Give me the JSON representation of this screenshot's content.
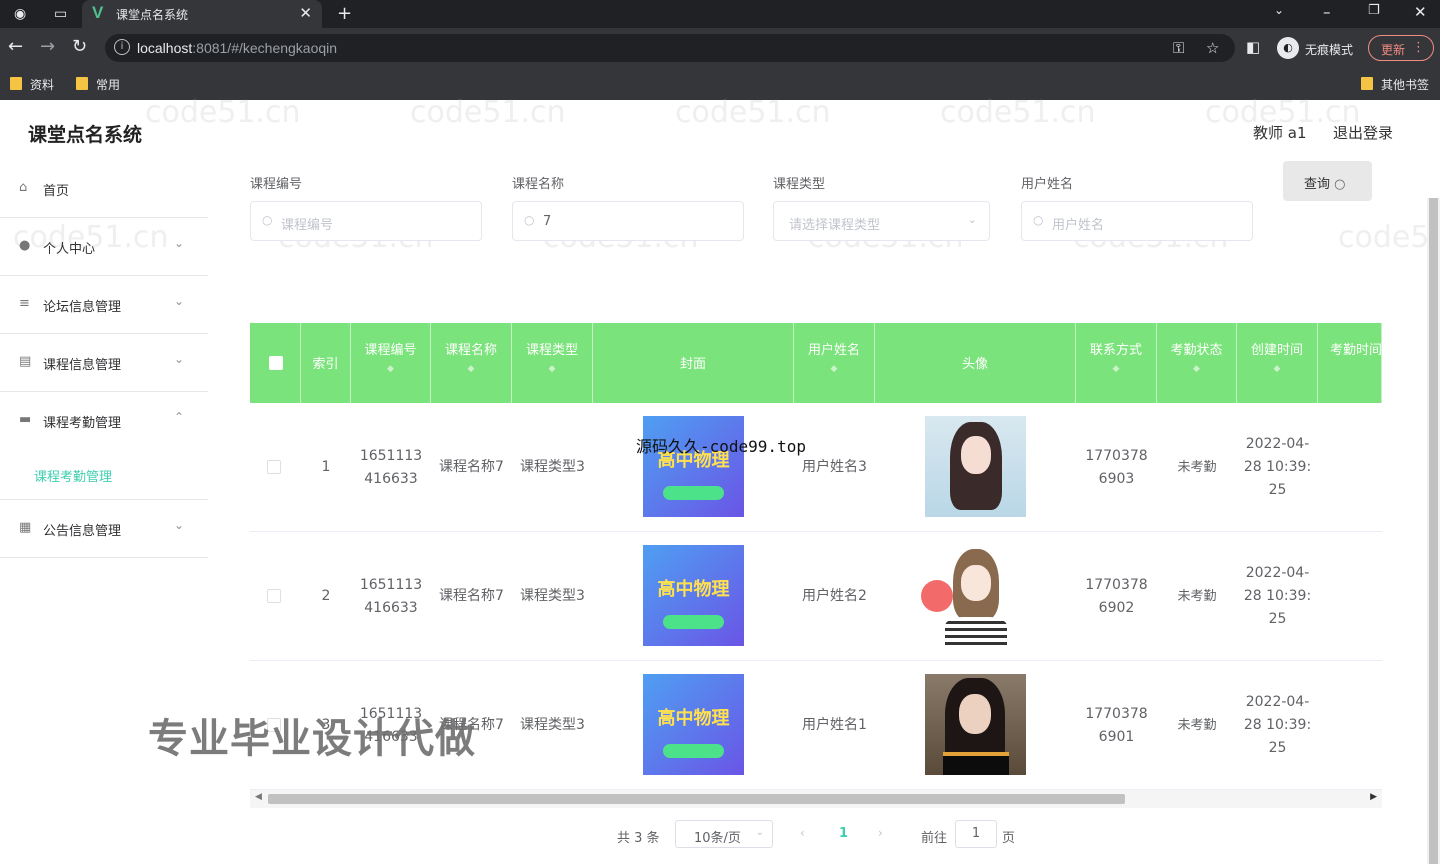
{
  "browser": {
    "tab_title": "课堂点名系统",
    "url_host": "localhost",
    "url_rest": ":8081/#/kechengkaoqin",
    "incognito_label": "无痕模式",
    "update_label": "更新",
    "bookmarks": [
      "资料",
      "常用"
    ],
    "other_bookmarks": "其他书签"
  },
  "app": {
    "title": "课堂点名系统",
    "user": "教师 a1",
    "logout": "退出登录"
  },
  "sidebar": {
    "items": [
      {
        "label": "首页",
        "icon": "home-icon"
      },
      {
        "label": "个人中心",
        "icon": "user-icon"
      },
      {
        "label": "论坛信息管理",
        "icon": "list-icon"
      },
      {
        "label": "课程信息管理",
        "icon": "document-icon"
      },
      {
        "label": "课程考勤管理",
        "icon": "folder-icon"
      },
      {
        "label": "公告信息管理",
        "icon": "grid-icon"
      }
    ],
    "submenu_active": "课程考勤管理"
  },
  "search": {
    "course_no_label": "课程编号",
    "course_no_placeholder": "课程编号",
    "course_name_label": "课程名称",
    "course_name_value": "7",
    "course_type_label": "课程类型",
    "course_type_placeholder": "请选择课程类型",
    "user_name_label": "用户姓名",
    "user_name_placeholder": "用户姓名",
    "button_label": "查询"
  },
  "table": {
    "headers": [
      "索引",
      "课程编号",
      "课程名称",
      "课程类型",
      "封面",
      "用户姓名",
      "头像",
      "联系方式",
      "考勤状态",
      "创建时间",
      "考勤时间"
    ],
    "rows": [
      {
        "index": "1",
        "course_no": "1651113416633",
        "course_name": "课程名称7",
        "course_type": "课程类型3",
        "cover_text": "高中物理",
        "user_name": "用户姓名3",
        "phone": "17703786903",
        "status": "未考勤",
        "created": "2022-04-28 10:39:25"
      },
      {
        "index": "2",
        "course_no": "1651113416633",
        "course_name": "课程名称7",
        "course_type": "课程类型3",
        "cover_text": "高中物理",
        "user_name": "用户姓名2",
        "phone": "17703786902",
        "status": "未考勤",
        "created": "2022-04-28 10:39:25"
      },
      {
        "index": "3",
        "course_no": "1651113416633",
        "course_name": "课程名称7",
        "course_type": "课程类型3",
        "cover_text": "高中物理",
        "user_name": "用户姓名1",
        "phone": "17703786901",
        "status": "未考勤",
        "created": "2022-04-28 10:39:25"
      }
    ]
  },
  "pagination": {
    "total": "共 3 条",
    "page_size": "10条/页",
    "current": "1",
    "goto_label": "前往",
    "goto_value": "1",
    "page_label": "页"
  },
  "overlays": {
    "watermark": "code51.cn",
    "code99": "源码久久-code99.top",
    "ad": "专业毕业设计代做"
  },
  "colors": {
    "header_green": "#7be37b",
    "accent": "#3fcfb0"
  }
}
